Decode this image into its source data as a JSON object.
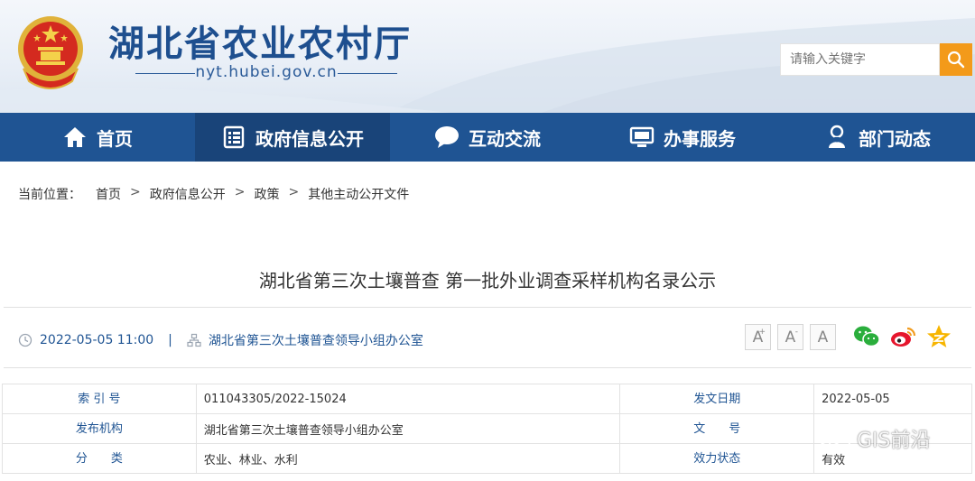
{
  "header": {
    "site_title": "湖北省农业农村厅",
    "site_domain": "nyt.hubei.gov.cn",
    "emblem_icon": "national-emblem",
    "search": {
      "placeholder": "请输入关键字",
      "button_icon": "search-icon"
    }
  },
  "nav": {
    "items": [
      {
        "label": "首页",
        "icon": "home-icon",
        "active": false
      },
      {
        "label": "政府信息公开",
        "icon": "document-list-icon",
        "active": true
      },
      {
        "label": "互动交流",
        "icon": "chat-bubble-icon",
        "active": false
      },
      {
        "label": "办事服务",
        "icon": "monitor-icon",
        "active": false
      },
      {
        "label": "部门动态",
        "icon": "person-pin-icon",
        "active": false
      }
    ]
  },
  "breadcrumb": {
    "label": "当前位置：",
    "items": [
      "首页",
      "政府信息公开",
      "政策",
      "其他主动公开文件"
    ],
    "separator": ">"
  },
  "article": {
    "title": "湖北省第三次土壤普查 第一批外业调查采样机构名录公示",
    "datetime": "2022-05-05 11:00",
    "divider": "|",
    "source": "湖北省第三次土壤普查领导小组办公室",
    "font_buttons": [
      "A",
      "A",
      "A"
    ],
    "share_icons": [
      "wechat-icon",
      "weibo-icon",
      "qzone-icon"
    ]
  },
  "info_table": {
    "rows": [
      {
        "k1": "索 引 号",
        "v1": "011043305/2022-15024",
        "k2": "发文日期",
        "v2": "2022-05-05"
      },
      {
        "k1": "发布机构",
        "v1": "湖北省第三次土壤普查领导小组办公室",
        "k2": "文　　号",
        "v2": ""
      },
      {
        "k1": "分　　类",
        "v1": "农业、林业、水利",
        "k2": "效力状态",
        "v2": "有效"
      }
    ]
  },
  "watermark": {
    "text": "GIS前沿"
  },
  "colors": {
    "primary": "#1f5493",
    "active_nav": "#194479",
    "accent": "#f39a1a",
    "title": "#1e4f8f"
  }
}
